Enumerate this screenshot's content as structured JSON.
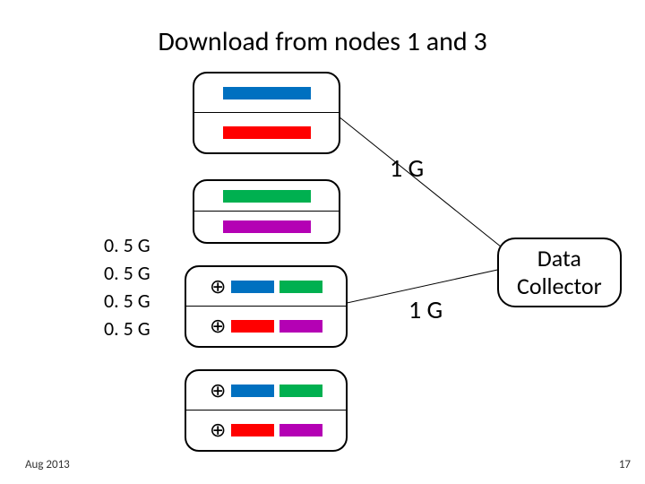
{
  "title": "Download from nodes 1 and 3",
  "labels": {
    "top_rate": "1 G",
    "mid_rate": "1 G",
    "collector": "Data\nCollector"
  },
  "legend": [
    {
      "label": "0. 5 G",
      "color": "blu"
    },
    {
      "label": "0. 5 G",
      "color": "red"
    },
    {
      "label": "0. 5 G",
      "color": "grn"
    },
    {
      "label": "0. 5 G",
      "color": "mag"
    }
  ],
  "footer": {
    "date": "Aug 2013",
    "page": "17"
  },
  "plus_symbol": "⊕"
}
